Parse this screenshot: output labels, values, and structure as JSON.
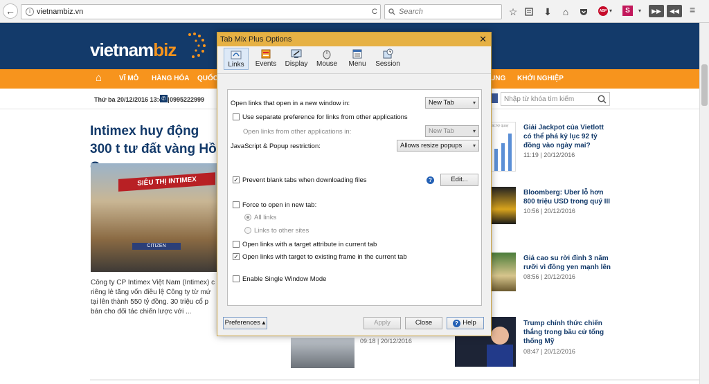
{
  "browser": {
    "url": "vietnambiz.vn",
    "search_placeholder": "Search",
    "back_glyph": "←",
    "reload_glyph": "C",
    "info_glyph": "i",
    "abp_badge": "ABP",
    "s_badge": "S"
  },
  "site": {
    "logo_a": "vietnam",
    "logo_b": "biz",
    "nav": [
      "VĨ MÔ",
      "HÀNG HÓA",
      "QUỐC T",
      "UNG",
      "KHỞI NGHIỆP"
    ],
    "date": "Thứ ba 20/12/2016 13:41 |",
    "phone": "0995222999",
    "search_placeholder": "Nhập từ khóa tìm kiếm",
    "headline": "Intimex huy động 300 t tư đất vàng Hồ Gươm",
    "img_sign": "SIÊU THỊ INTIMEX",
    "img_sign2": "CITIZEN",
    "summary": "Công ty CP Intimex Việt Nam (Intimex) c riêng lẻ tăng vốn điều lệ Công ty từ mứ tại lên thành 550 tỷ đồng. 30 triệu cổ p bán cho đối tác chiến lược với ...",
    "mid_time": "09:18 | 20/12/2016",
    "chart_caption": "các kỳ quay",
    "side": [
      {
        "title": "Giải Jackpot của Vietlott có thể phá kỷ lục 92 tỷ đồng vào ngày mai?",
        "time": "11:19 | 20/12/2016"
      },
      {
        "title": "Bloomberg: Uber lỗ hơn 800 triệu USD trong quý III",
        "time": "10:56 | 20/12/2016"
      },
      {
        "title": "Giá cao su rời đỉnh 3 năm rưỡi vì đồng yen mạnh lên",
        "time": "08:56 | 20/12/2016"
      },
      {
        "title": "Trump chính thức chiến thắng trong bầu cử tổng thống Mỹ",
        "time": "08:47 | 20/12/2016"
      }
    ]
  },
  "dialog": {
    "title": "Tab Mix Plus Options",
    "close": "✕",
    "tabs": [
      "Links",
      "Events",
      "Display",
      "Mouse",
      "Menu",
      "Session"
    ],
    "open_links_label": "Open links that open in a new window in:",
    "open_links_value": "New Tab",
    "use_sep_pref": "Use separate preference for links from other applications",
    "other_apps_label": "Open links from other applications in:",
    "other_apps_value": "New Tab",
    "js_label": "JavaScript & Popup restriction:",
    "js_value": "Allows resize popups",
    "prevent_blank": "Prevent blank tabs when downloading files",
    "help_glyph": "?",
    "edit": "Edit...",
    "force_open": "Force to open in new tab:",
    "all_links": "All links",
    "links_other": "Links to other sites",
    "target_attr": "Open links with a target attribute in current tab",
    "target_frame": "Open links with target to existing frame in the current tab",
    "single_window": "Enable Single Window Mode",
    "check_glyph": "✓",
    "arrow_glyph": "▾",
    "preferences": "Preferences ▴",
    "apply": "Apply",
    "close_btn": "Close",
    "help": "Help"
  },
  "colors": {
    "site_blue": "#133a6a",
    "site_orange": "#f7941d",
    "title_bar": "#e6b144"
  }
}
